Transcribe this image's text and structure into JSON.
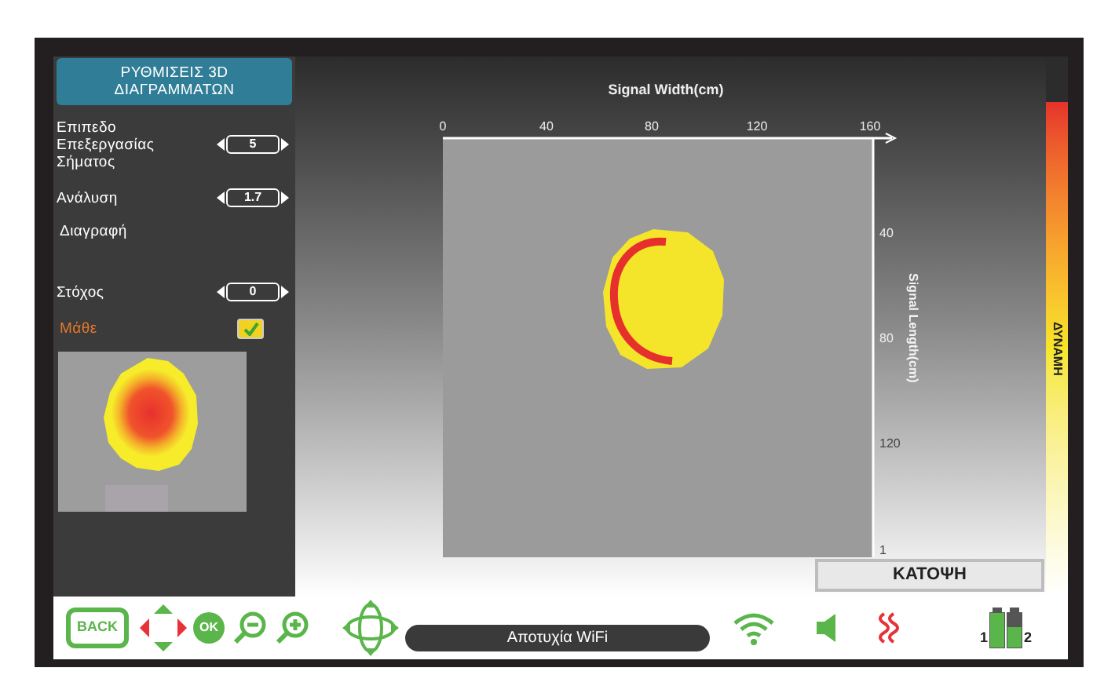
{
  "panel": {
    "title": "ΡΥΘΜΙΣΕΙΣ 3D ΔΙΑΓΡΑΜΜΑΤΩΝ",
    "settings": [
      {
        "kind": "stepper",
        "label": "Επιπεδο Επεξεργασίας Σήματος",
        "value": "5"
      },
      {
        "kind": "stepper",
        "label": "Ανάλυση",
        "value": "1.7"
      },
      {
        "kind": "action",
        "label": "Διαγραφή"
      },
      {
        "kind": "stepper",
        "label": "Στόχος",
        "value": "0"
      },
      {
        "kind": "checkbox",
        "label": "Μάθε",
        "checked": true
      }
    ]
  },
  "plot": {
    "title": "Signal Width(cm)",
    "x_ticks": [
      "0",
      "40",
      "80",
      "120",
      "160"
    ],
    "y_label": "Signal Length(cm)",
    "y_ticks": [
      "40",
      "80",
      "120",
      "1"
    ]
  },
  "view_button": "ΚΑΤΟΨΗ",
  "power_scale": {
    "label": "ΔΥΝΑΜΗ"
  },
  "status": "Αποτυχία WiFi",
  "toolbar": {
    "back": "BACK",
    "ok": "OK"
  },
  "batteries": [
    {
      "label": "1",
      "level": 1
    },
    {
      "label": "2",
      "level": 0.6
    }
  ]
}
